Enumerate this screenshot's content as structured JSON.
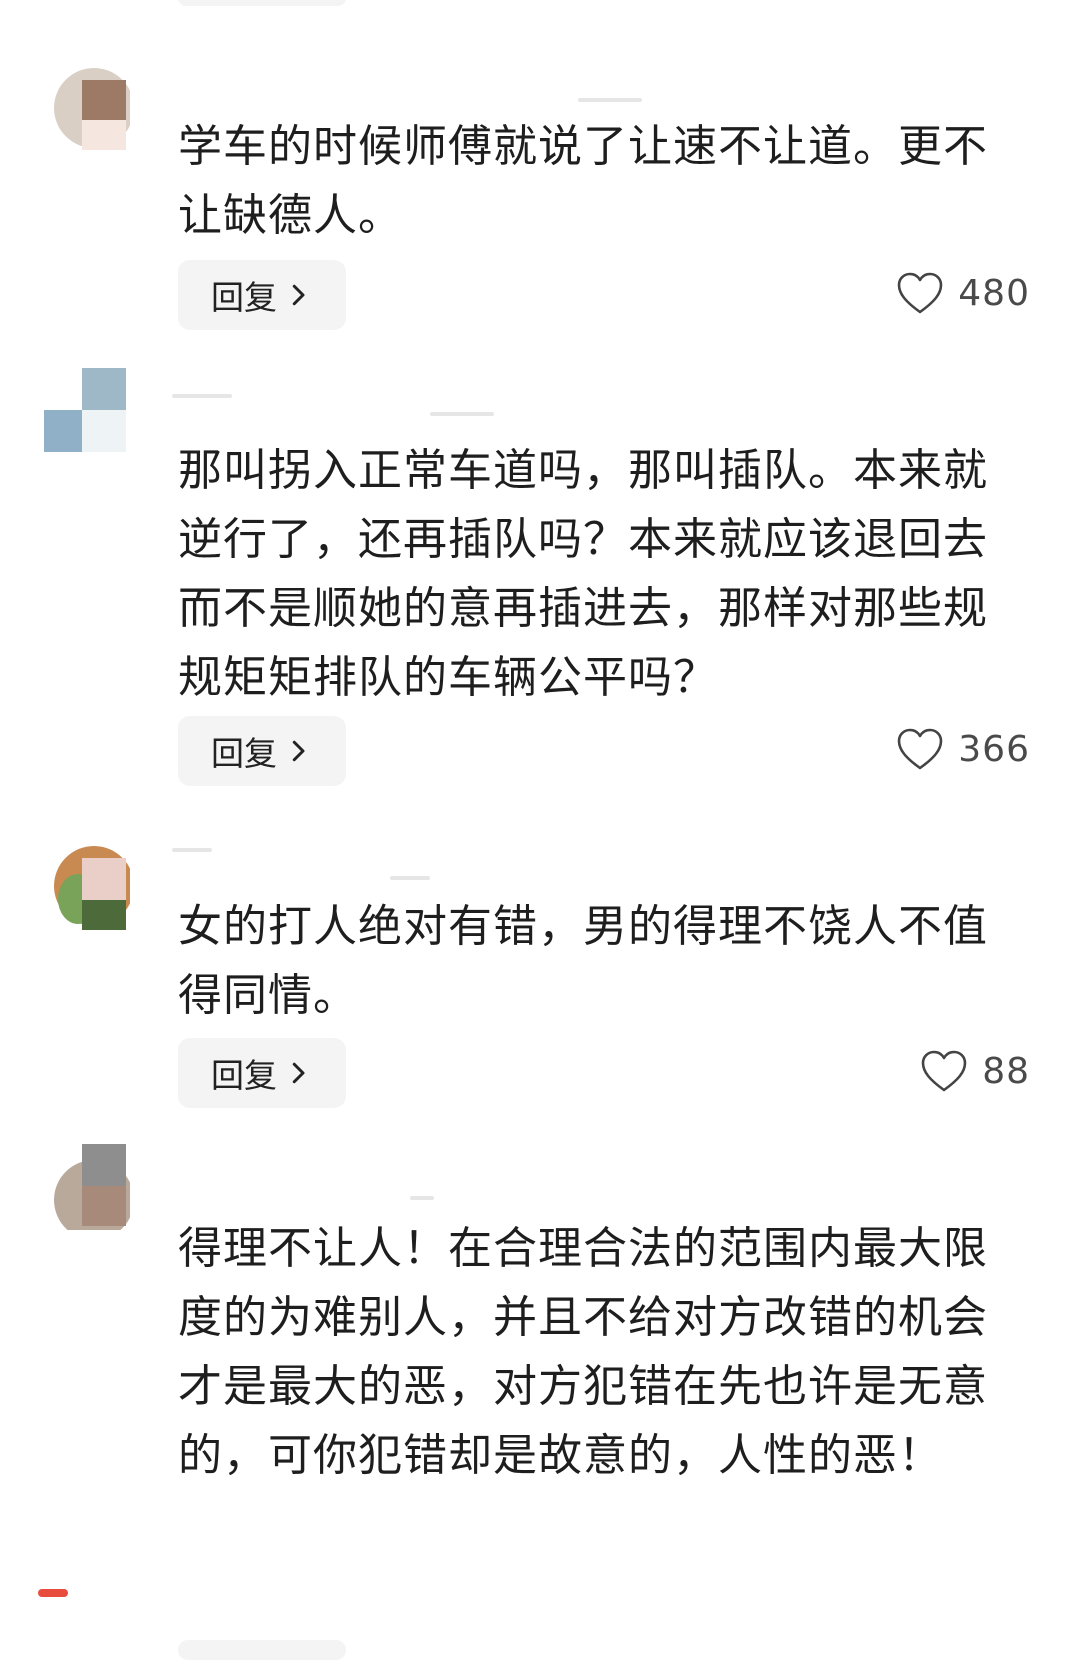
{
  "comments": [
    {
      "text": "学车的时候师傅就说了让速不让道。更不让缺德人。",
      "reply_label": "回复",
      "likes": "480"
    },
    {
      "text": "那叫拐入正常车道吗，那叫插队。本来就逆行了，还再插队吗？本来就应该退回去而不是顺她的意再插进去，那样对那些规规矩矩排队的车辆公平吗？",
      "reply_label": "回复",
      "likes": "366"
    },
    {
      "text": "女的打人绝对有错，男的得理不饶人不值得同情。",
      "reply_label": "回复",
      "likes": "88"
    },
    {
      "text": "得理不让人！在合理合法的范围内最大限度的为难别人，并且不给对方改错的机会才是最大的恶，对方犯错在先也许是无意的，可你犯错却是故意的，人性的恶！"
    }
  ],
  "icons": {
    "like": "heart-outline-icon",
    "reply_arrow": "chevron-right-icon"
  },
  "colors": {
    "reply_bg": "#f4f4f4",
    "text": "#1e1e1e",
    "count": "#4a4a4a"
  }
}
